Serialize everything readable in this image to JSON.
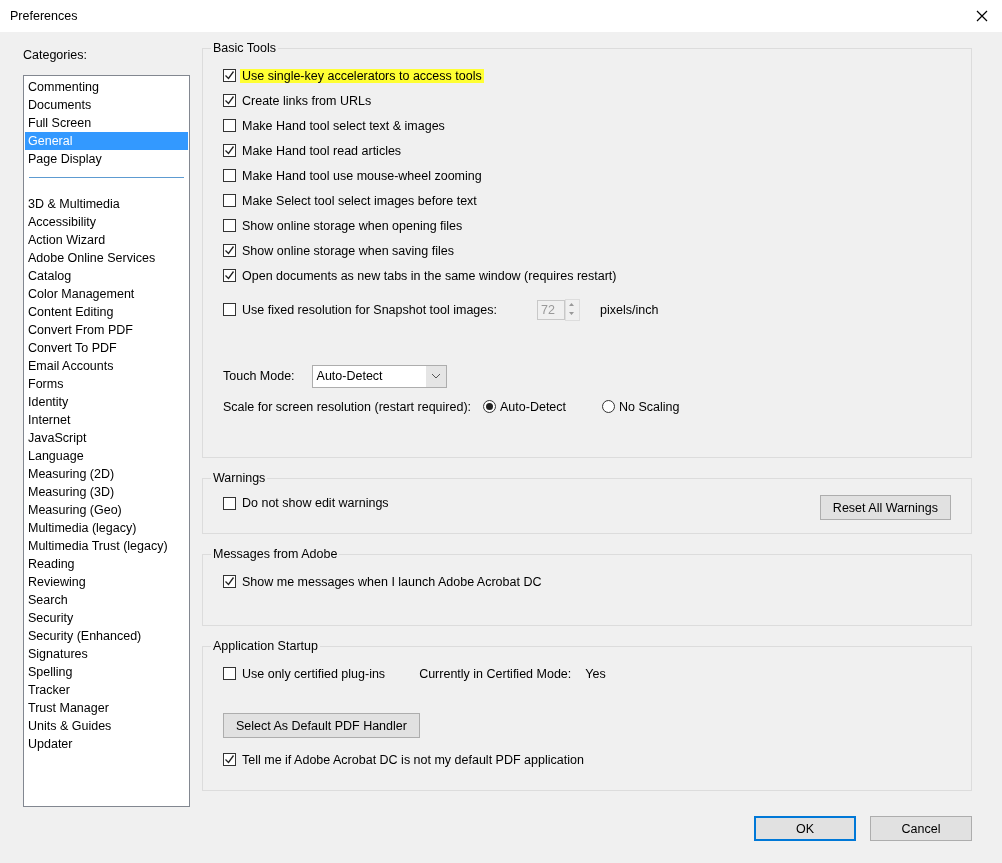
{
  "window": {
    "title": "Preferences"
  },
  "categories": {
    "label": "Categories:",
    "groups": [
      {
        "items": [
          {
            "label": "Commenting",
            "selected": false
          },
          {
            "label": "Documents",
            "selected": false
          },
          {
            "label": "Full Screen",
            "selected": false
          },
          {
            "label": "General",
            "selected": true
          },
          {
            "label": "Page Display",
            "selected": false
          }
        ]
      },
      {
        "items": [
          {
            "label": "3D & Multimedia",
            "selected": false
          },
          {
            "label": "Accessibility",
            "selected": false
          },
          {
            "label": "Action Wizard",
            "selected": false
          },
          {
            "label": "Adobe Online Services",
            "selected": false
          },
          {
            "label": "Catalog",
            "selected": false
          },
          {
            "label": "Color Management",
            "selected": false
          },
          {
            "label": "Content Editing",
            "selected": false
          },
          {
            "label": "Convert From PDF",
            "selected": false
          },
          {
            "label": "Convert To PDF",
            "selected": false
          },
          {
            "label": "Email Accounts",
            "selected": false
          },
          {
            "label": "Forms",
            "selected": false
          },
          {
            "label": "Identity",
            "selected": false
          },
          {
            "label": "Internet",
            "selected": false
          },
          {
            "label": "JavaScript",
            "selected": false
          },
          {
            "label": "Language",
            "selected": false
          },
          {
            "label": "Measuring (2D)",
            "selected": false
          },
          {
            "label": "Measuring (3D)",
            "selected": false
          },
          {
            "label": "Measuring (Geo)",
            "selected": false
          },
          {
            "label": "Multimedia (legacy)",
            "selected": false
          },
          {
            "label": "Multimedia Trust (legacy)",
            "selected": false
          },
          {
            "label": "Reading",
            "selected": false
          },
          {
            "label": "Reviewing",
            "selected": false
          },
          {
            "label": "Search",
            "selected": false
          },
          {
            "label": "Security",
            "selected": false
          },
          {
            "label": "Security (Enhanced)",
            "selected": false
          },
          {
            "label": "Signatures",
            "selected": false
          },
          {
            "label": "Spelling",
            "selected": false
          },
          {
            "label": "Tracker",
            "selected": false
          },
          {
            "label": "Trust Manager",
            "selected": false
          },
          {
            "label": "Units & Guides",
            "selected": false
          },
          {
            "label": "Updater",
            "selected": false
          }
        ]
      }
    ]
  },
  "basic_tools": {
    "title": "Basic Tools",
    "options": [
      {
        "label": "Use single-key accelerators to access tools",
        "checked": true,
        "highlighted": true
      },
      {
        "label": "Create links from URLs",
        "checked": true,
        "highlighted": false
      },
      {
        "label": "Make Hand tool select text & images",
        "checked": false,
        "highlighted": false
      },
      {
        "label": "Make Hand tool read articles",
        "checked": true,
        "highlighted": false
      },
      {
        "label": "Make Hand tool use mouse-wheel zooming",
        "checked": false,
        "highlighted": false
      },
      {
        "label": "Make Select tool select images before text",
        "checked": false,
        "highlighted": false
      },
      {
        "label": "Show online storage when opening files",
        "checked": false,
        "highlighted": false
      },
      {
        "label": "Show online storage when saving files",
        "checked": true,
        "highlighted": false
      },
      {
        "label": "Open documents as new tabs in the same window (requires restart)",
        "checked": true,
        "highlighted": false
      }
    ],
    "fixed_resolution": {
      "label": "Use fixed resolution for Snapshot tool images:",
      "checked": false,
      "value": "72",
      "unit": "pixels/inch"
    },
    "touch_mode": {
      "label": "Touch Mode:",
      "value": "Auto-Detect"
    },
    "scale": {
      "label": "Scale for screen resolution (restart required):",
      "options": [
        {
          "label": "Auto-Detect",
          "selected": true
        },
        {
          "label": "No Scaling",
          "selected": false
        }
      ]
    }
  },
  "warnings": {
    "title": "Warnings",
    "option": {
      "label": "Do not show edit warnings",
      "checked": false
    },
    "button": "Reset All Warnings"
  },
  "messages": {
    "title": "Messages from Adobe",
    "option": {
      "label": "Show me messages when I launch Adobe Acrobat DC",
      "checked": true
    }
  },
  "startup": {
    "title": "Application Startup",
    "option": {
      "label": "Use only certified plug-ins",
      "checked": false
    },
    "mode_label": "Currently in Certified Mode:",
    "mode_value": "Yes",
    "button": "Select As Default PDF Handler",
    "default_option": {
      "label": "Tell me if Adobe Acrobat DC is not my default PDF application",
      "checked": true
    }
  },
  "buttons": [
    {
      "label": "OK",
      "kind": "default"
    },
    {
      "label": "Cancel",
      "kind": "normal"
    }
  ]
}
